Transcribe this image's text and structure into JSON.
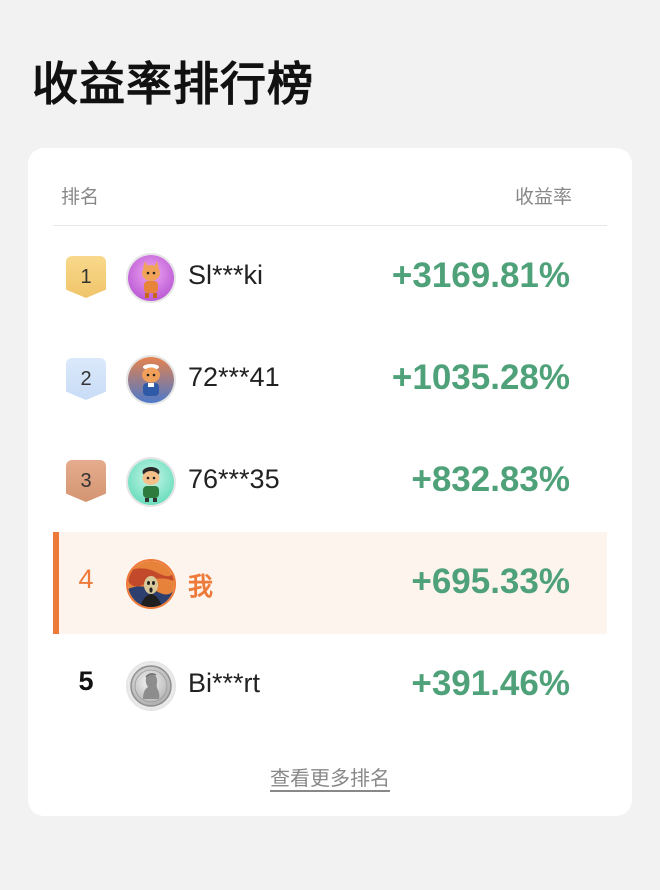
{
  "page": {
    "title": "收益率排行榜"
  },
  "table": {
    "header_rank": "排名",
    "header_rate": "收益率",
    "rows": [
      {
        "rank": "1",
        "name": "Sl***ki",
        "rate": "+3169.81%",
        "badge": "gold",
        "avatar": "pink-cartoon-figure-avatar"
      },
      {
        "rank": "2",
        "name": "72***41",
        "rate": "+1035.28%",
        "badge": "silver",
        "avatar": "sailor-cartoon-figure-avatar"
      },
      {
        "rank": "3",
        "name": "76***35",
        "rate": "+832.83%",
        "badge": "bronze",
        "avatar": "teal-cartoon-figure-avatar"
      },
      {
        "rank": "4",
        "name": "我",
        "rate": "+695.33%",
        "badge": "none",
        "avatar": "scream-painting-avatar",
        "is_me": true
      },
      {
        "rank": "5",
        "name": "Bi***rt",
        "rate": "+391.46%",
        "badge": "none",
        "avatar": "coin-portrait-avatar"
      }
    ],
    "more_link": "查看更多排名"
  },
  "colors": {
    "positive_rate": "#4ea178",
    "me_accent": "#ee7a3a",
    "me_row_bg": "#fdf4ee",
    "gold": "#f0c46a",
    "silver": "#c8dcf6",
    "bronze": "#d49472"
  }
}
